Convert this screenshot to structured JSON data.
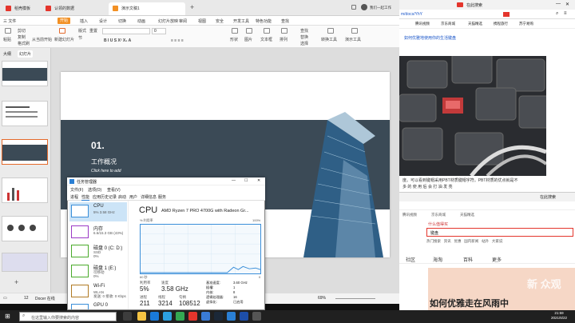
{
  "wps": {
    "tabs": [
      {
        "label": "稻壳模板",
        "color": "#e4352c"
      },
      {
        "label": "认领的数据",
        "color": "#e4352c"
      },
      {
        "label": "演示文稿1",
        "color": "#f29024"
      }
    ],
    "user": "我们一起工作",
    "menu": [
      "三 文件",
      "开始",
      "插入",
      "设计",
      "切换",
      "动画",
      "幻灯片放映",
      "审阅",
      "视图",
      "安全",
      "开发工具",
      "特色功能",
      "查找"
    ],
    "toolbar": {
      "paste": "粘贴",
      "cut": "剪切",
      "copy": "复制",
      "format_painter": "格式刷",
      "from_current": "从当前开始",
      "new_slide": "新建幻灯片",
      "layout": "版式",
      "section": "节",
      "reset": "重置",
      "font_size": "0",
      "shape": "形状",
      "picture": "图片",
      "textbox": "文本框",
      "arrange": "排列",
      "find": "查找",
      "replace": "替换",
      "select": "选择",
      "convert": "转换工具",
      "shortcut": "演示工具"
    },
    "panel_tabs": {
      "outline": "大纲",
      "slides": "幻灯片"
    },
    "slide": {
      "number": "01.",
      "title": "工作概况",
      "subtitle": "Click here to add"
    },
    "status": {
      "slide": "12",
      "theme": "Docer 在线",
      "zoom": "69%"
    }
  },
  "browser": {
    "tab": "在此搜索",
    "url": "m/docs/YhY",
    "bookmarks": [
      "腾讯视频",
      "京东商城",
      "天猫精选",
      "携程旅行",
      "苏宁易购"
    ],
    "question": "如何优雅地使用你的生活键盘",
    "body": "度。可以看到键帽采用PBT材质键帽字符。PBT材质的优点就是不",
    "body2": "多 的 使 用 后 会 打 油 发 亮"
  },
  "browser2": {
    "tab": "在此搜索",
    "search_value": "键盘",
    "hint": "什么值得买",
    "links": [
      "热门搜索",
      "资讯",
      "优惠",
      "国内新闻",
      "站外",
      "大家说"
    ],
    "nav": [
      "社区",
      "海淘",
      "百科",
      "更多"
    ],
    "headline": "如何优雅走在风雨中",
    "watermark": "新 众观"
  },
  "task_manager": {
    "title": "任务管理器",
    "menu": [
      "文件(F)",
      "选项(O)",
      "查看(V)"
    ],
    "tabs": [
      "进程",
      "性能",
      "应用历史记录",
      "启动",
      "用户",
      "详细信息",
      "服务"
    ],
    "side": [
      {
        "label": "CPU",
        "sub": "5% 3.58 GHz",
        "color": "#3b8fd9"
      },
      {
        "label": "内存",
        "sub": "6.6/15.3 GB (43%)",
        "color": "#9b3ac6"
      },
      {
        "label": "磁盘 0 (C: D:)",
        "sub": "SSD\n0%",
        "color": "#4bab2c"
      },
      {
        "label": "磁盘 1 (E:)",
        "sub": "可移动\n0%",
        "color": "#4bab2c"
      },
      {
        "label": "Wi-Fi",
        "sub": "WLAN\n发送: 0 接收: 0 Kbps",
        "color": "#b17b24"
      },
      {
        "label": "GPU 0",
        "sub": "",
        "color": "#3b8fd9"
      }
    ],
    "cpu_title": "CPU",
    "cpu_model": "AMD Ryzen 7 PRO 4700G with Radeon Gr...",
    "graph_label": "% 利用率",
    "graph_max": "100%",
    "graph_time": "60 秒",
    "graph_min": "0",
    "stats": {
      "util_label": "利用率",
      "util": "5%",
      "speed_label": "速度",
      "speed": "3.58 GHz",
      "proc_label": "进程",
      "proc": "211",
      "threads_label": "线程",
      "threads": "3214",
      "handles_label": "句柄",
      "handles": "108512"
    },
    "right_stats": [
      {
        "k": "基准速度:",
        "v": "3.60 GHz"
      },
      {
        "k": "插槽:",
        "v": "1"
      },
      {
        "k": "内核:",
        "v": "8"
      },
      {
        "k": "逻辑处理器:",
        "v": "16"
      },
      {
        "k": "虚拟化:",
        "v": "已启用"
      }
    ]
  },
  "taskbar": {
    "search": "在这里输入你要搜索的内容",
    "time": "21:59",
    "date": "2021/6/22"
  }
}
